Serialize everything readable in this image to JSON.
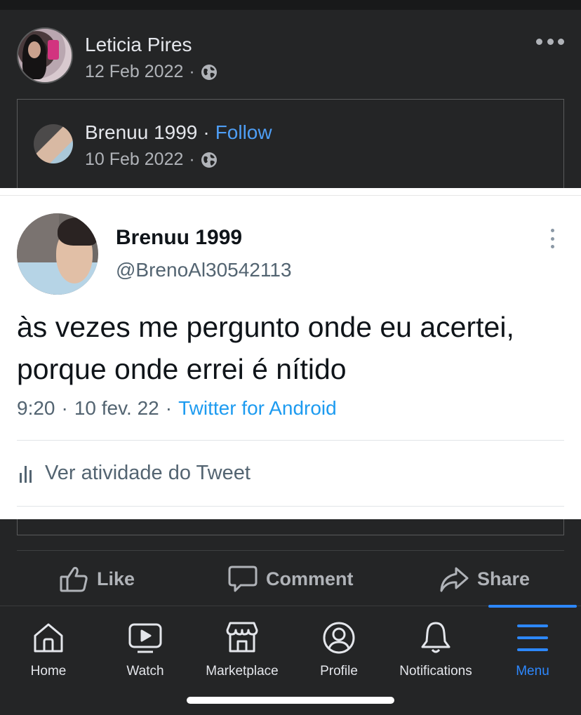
{
  "post": {
    "author": "Leticia Pires",
    "date": "12 Feb 2022",
    "separator": "·",
    "audience_icon": "globe-icon",
    "more_icon": "more-options-icon"
  },
  "shared": {
    "author": "Brenuu 1999",
    "separator": "·",
    "follow_label": "Follow",
    "date": "10 Feb 2022",
    "audience_icon": "globe-icon"
  },
  "tweet": {
    "name": "Brenuu 1999",
    "handle": "@BrenoAl30542113",
    "text": "às vezes me pergunto onde eu acertei, porque onde errei é nítido",
    "time": "9:20",
    "sep1": "·",
    "date": "10 fev. 22",
    "sep2": "·",
    "source": "Twitter for Android",
    "activity_label": "Ver atividade do Tweet"
  },
  "actions": {
    "like": "Like",
    "comment": "Comment",
    "share": "Share"
  },
  "nav": {
    "items": [
      {
        "label": "Home",
        "icon": "home-icon"
      },
      {
        "label": "Watch",
        "icon": "watch-icon"
      },
      {
        "label": "Marketplace",
        "icon": "marketplace-icon"
      },
      {
        "label": "Profile",
        "icon": "profile-icon"
      },
      {
        "label": "Notifications",
        "icon": "bell-icon"
      },
      {
        "label": "Menu",
        "icon": "menu-icon"
      }
    ],
    "active": "Menu",
    "active_color": "#2d88ff"
  },
  "colors": {
    "background": "#242526",
    "link": "#4e9ef5",
    "tweet_source": "#1d9bf0"
  }
}
